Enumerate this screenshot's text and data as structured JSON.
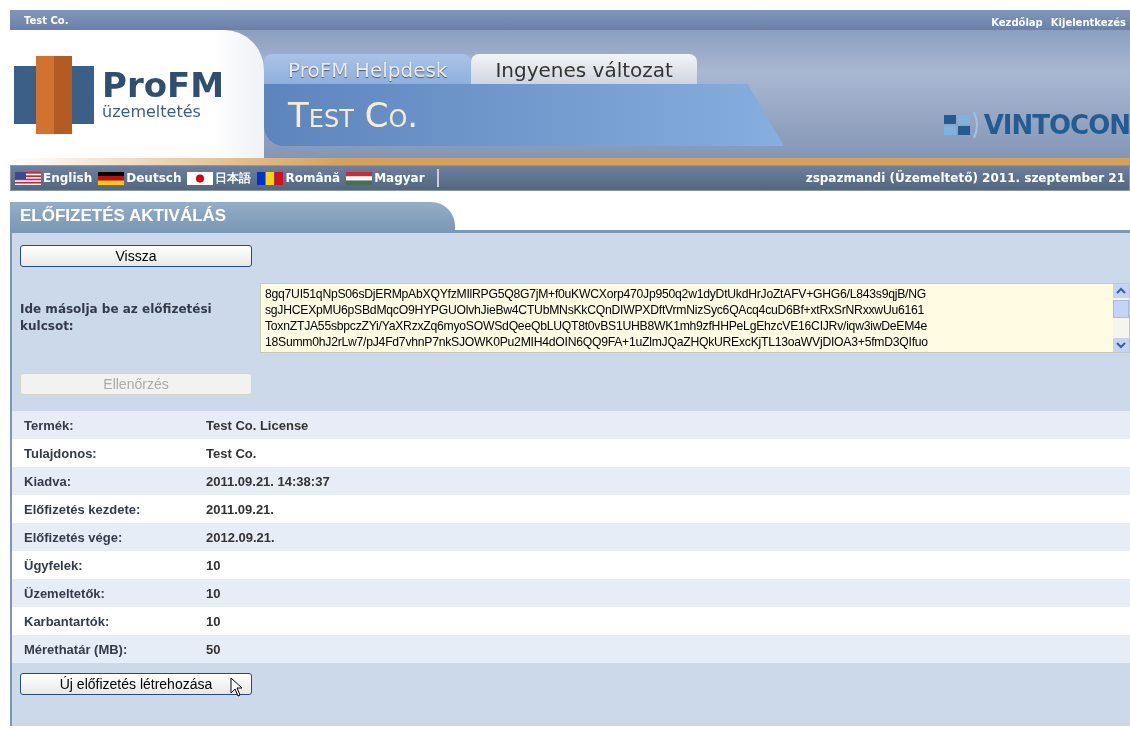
{
  "top_bar": {
    "company": "Test Co.",
    "links": [
      "Kezdőlap",
      "Kijelentkezés"
    ]
  },
  "logo": {
    "name": "ProFM",
    "subtitle": "üzemeltetés"
  },
  "tabs": [
    {
      "label": "ProFM Helpdesk",
      "selected": true
    },
    {
      "label": "Ingyenes változat",
      "selected": false
    }
  ],
  "header_title": "Test Co.",
  "partner_logo": "VINTOCON",
  "languages": [
    {
      "label": "English",
      "kind": "us"
    },
    {
      "label": "Deutsch",
      "kind": "de"
    },
    {
      "label": "日本語",
      "kind": "jp"
    },
    {
      "label": "Română",
      "kind": "ro"
    },
    {
      "label": "Magyar",
      "kind": "hu"
    }
  ],
  "user_info": "zspazmandi (Üzemeltető) 2011. szeptember 21",
  "section_title": "ELŐFIZETÉS AKTIVÁLÁS",
  "back_button": "Vissza",
  "key_field": {
    "label": "Ide másolja be az előfizetési kulcsot:",
    "lines": [
      "8gq7UI51qNpS06sDjERMpAbXQYfzMIlRPG5Q8G7jM+f0uKWCXorp470Jp950q2w1dyDtUkdHrJoZtAFV+GHG6/L843s9qjB/NG",
      "sgJHCEXpMU6pSBdMqcO9HYPGUOlvhJieBw4CTUbMNsKkCQnDIWPXDftVrmNizSyc6QAcq4cuD6Bf+xtRxSrNRxxwUu6161",
      "ToxnZTJA55sbpczZYi/YaXRzxZq6myoSOWSdQeeQbLUQT8t0vBS1UHB8WK1mh9zfHHPeLgEhzcVE16CIJRv/iqw3iwDeEM4e",
      "18Summ0hJ2rLw7/pJ4Fd7vhnP7nkSJOWK0Pu2MIH4dOIN6QQ9FA+1uZlmJQaZHQkURExcKjTL13oaWVjDIOA3+5fmD3QIfuo"
    ]
  },
  "check_button": {
    "label": "Ellenőrzés",
    "disabled": true
  },
  "details": [
    {
      "label": "Termék:",
      "value": "Test Co. License"
    },
    {
      "label": "Tulajdonos:",
      "value": "Test Co."
    },
    {
      "label": "Kiadva:",
      "value": "2011.09.21. 14:38:37"
    },
    {
      "label": "Előfizetés kezdete:",
      "value": "2011.09.21."
    },
    {
      "label": "Előfizetés vége:",
      "value": "2012.09.21."
    },
    {
      "label": "Ügyfelek:",
      "value": "10"
    },
    {
      "label": "Üzemeltetők:",
      "value": "10"
    },
    {
      "label": "Karbantartók:",
      "value": "10"
    },
    {
      "label": "Mérethatár (MB):",
      "value": "50"
    }
  ],
  "create_button": "Új előfizetés létrehozása"
}
